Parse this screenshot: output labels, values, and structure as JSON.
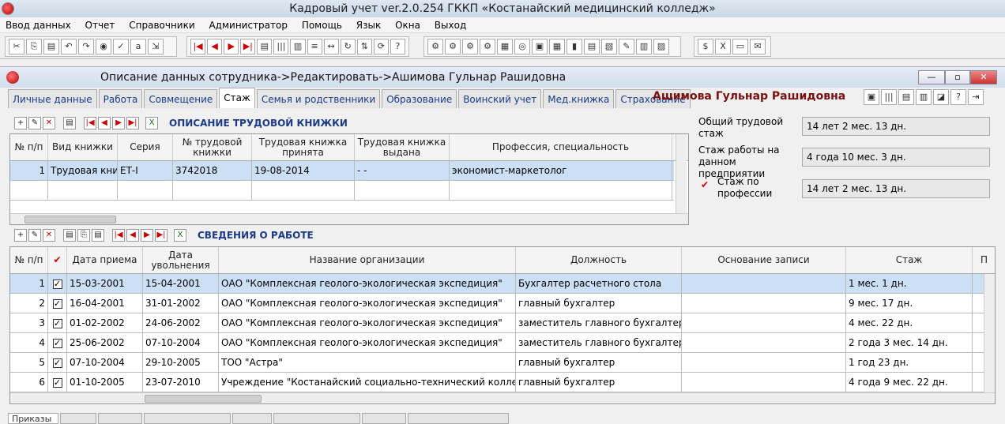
{
  "app": {
    "title": "Кадровый учет ver.2.0.254 ГККП «Костанайский медицинский колледж»"
  },
  "menu": [
    "Ввод данных",
    "Отчет",
    "Справочники",
    "Администратор",
    "Помощь",
    "Язык",
    "Окна",
    "Выход"
  ],
  "window": {
    "title": "Описание данных сотрудника->Редактировать->Ашимова Гульнар Рашидовна",
    "employee": "Ашимова Гульнар Рашидовна"
  },
  "tabs": [
    "Личные данные",
    "Работа",
    "Совмещение",
    "Стаж",
    "Семья и родственники",
    "Образование",
    "Воинский учет",
    "Мед.книжка",
    "Страхование"
  ],
  "active_tab": "Стаж",
  "workbook": {
    "title": "ОПИСАНИЕ ТРУДОВОЙ КНИЖКИ",
    "columns": [
      "№ п/п",
      "Вид книжки",
      "Серия",
      "№ трудовой книжки",
      "Трудовая книжка принята",
      "Трудовая книжка выдана",
      "Профессия, специальность"
    ],
    "rows": [
      [
        "1",
        "Трудовая книж",
        "ЕТ-I",
        "3742018",
        "19-08-2014",
        "- -",
        "экономист-маркетолог"
      ]
    ]
  },
  "summary": {
    "total_label": "Общий трудовой стаж",
    "total_value": "14 лет 2 мес. 13 дн.",
    "company_label": "Стаж работы на данном предприятии",
    "company_value": "4 года 10 мес. 3 дн.",
    "prof_label": "Стаж по профессии",
    "prof_value": "14 лет 2 мес. 13 дн."
  },
  "jobs": {
    "title": "СВЕДЕНИЯ О РАБОТЕ",
    "columns": [
      "№ п/п",
      "",
      "Дата приема",
      "Дата увольнения",
      "Название организации",
      "Должность",
      "Основание записи",
      "Стаж",
      "П"
    ],
    "rows": [
      {
        "n": "1",
        "from": "15-03-2001",
        "to": "15-04-2001",
        "org": "ОАО \"Комплексная геолого-экологическая экспедиция\"",
        "pos": "Бухгалтер расчетного стола",
        "basis": "",
        "stazh": "1 мес. 1 дн."
      },
      {
        "n": "2",
        "from": "16-04-2001",
        "to": "31-01-2002",
        "org": "ОАО \"Комплексная геолого-экологическая экспедиция\"",
        "pos": "главный бухгалтер",
        "basis": "",
        "stazh": "9 мес. 17 дн."
      },
      {
        "n": "3",
        "from": "01-02-2002",
        "to": "24-06-2002",
        "org": "ОАО \"Комплексная геолого-экологическая экспедиция\"",
        "pos": "заместитель главного бухгалтера",
        "basis": "",
        "stazh": "4 мес. 22 дн."
      },
      {
        "n": "4",
        "from": "25-06-2002",
        "to": "07-10-2004",
        "org": "ОАО \"Комплексная геолого-экологическая экспедиция\"",
        "pos": "заместитель главного бухгалтера",
        "basis": "",
        "stazh": "2 года 3 мес. 14 дн."
      },
      {
        "n": "5",
        "from": "07-10-2004",
        "to": "29-10-2005",
        "org": "ТОО \"Астра\"",
        "pos": "главный бухгалтер",
        "basis": "",
        "stazh": "1 год 23 дн."
      },
      {
        "n": "6",
        "from": "01-10-2005",
        "to": "23-07-2010",
        "org": "Учреждение \"Костанайский социально-технический колледж\"",
        "pos": "главный бухгалтер",
        "basis": "",
        "stazh": "4 года 9 мес. 22 дн."
      }
    ]
  },
  "bottom_tabs": [
    "Приказы",
    "",
    "",
    "",
    "",
    "",
    "",
    ""
  ]
}
